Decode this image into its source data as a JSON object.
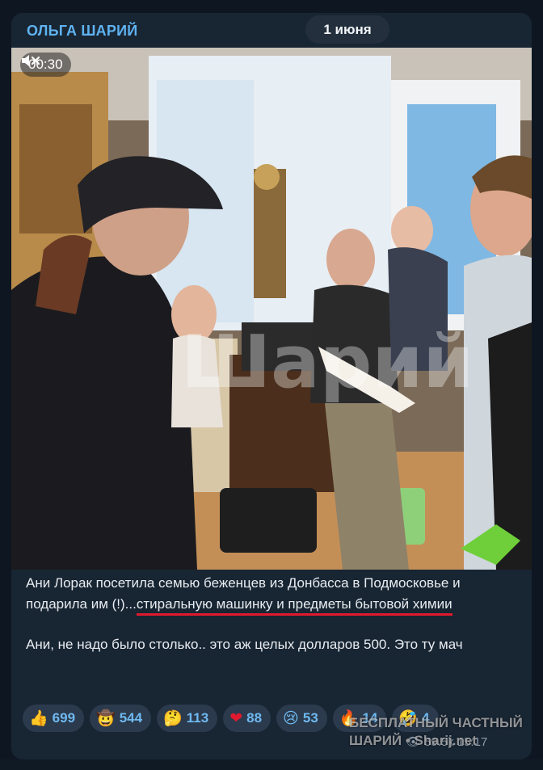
{
  "post": {
    "channel_name": "ОЛЬГА ШАРИЙ",
    "date": "1 июня",
    "video": {
      "duration": "00:30",
      "muted": true,
      "watermark_text": "Шарий"
    },
    "caption": {
      "p1_plain": "Ани Лорак посетила семью беженцев из Донбасса в Подмосковье и подарила им (!)...",
      "p1_underlined": "стиральную машинку и предметы бытовой химии",
      "p2": "Ани, не надо было столько.. это аж целых долларов 500. Это ту мач"
    },
    "reactions": [
      {
        "emoji": "👍",
        "icon": "thumbs-up-icon",
        "count": "699"
      },
      {
        "emoji": "🤠",
        "icon": "cowboy-face-icon",
        "count": "544"
      },
      {
        "emoji": "🤔",
        "icon": "thinking-face-icon",
        "count": "113"
      },
      {
        "emoji": "❤",
        "icon": "heart-icon",
        "count": "88"
      },
      {
        "emoji": "😢",
        "icon": "crying-face-icon",
        "count": "53"
      },
      {
        "emoji": "🔥",
        "icon": "fire-icon",
        "count": "14"
      },
      {
        "emoji": "🤣",
        "icon": "rofl-face-icon",
        "count": "4"
      }
    ],
    "views": "59.5k",
    "time": "15:17"
  },
  "overlay_watermark": {
    "line1": "БЕСПЛАТНЫЙ ЧАСТНЫЙ",
    "line2": "ШАРИЙ • Sharij.net"
  },
  "colors": {
    "background": "#0e1621",
    "card": "#182533",
    "accent": "#5fb3f0",
    "underline": "#e0192f",
    "reaction_bg": "#2b3a4c"
  }
}
